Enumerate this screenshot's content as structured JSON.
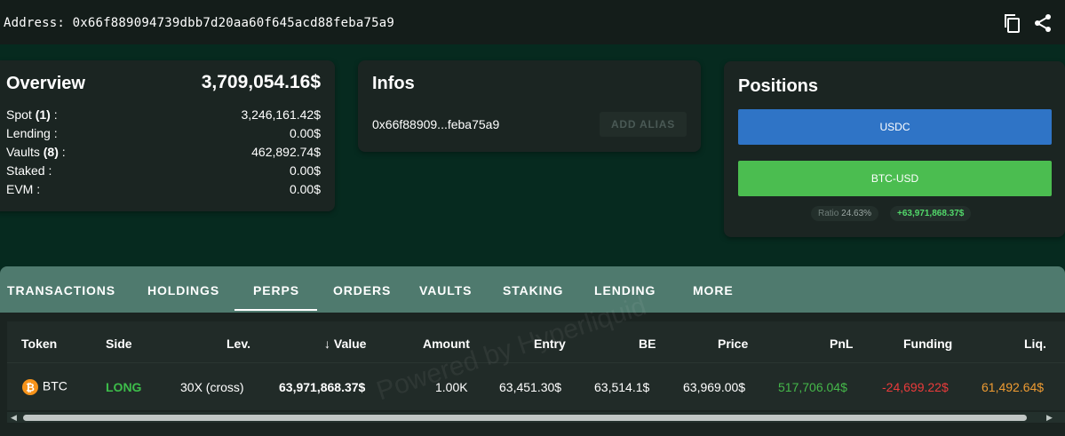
{
  "address_bar": {
    "text": "Address: 0x66f889094739dbb7d20aa60f645acd88feba75a9",
    "copy_icon": "copy-icon",
    "share_icon": "share-icon"
  },
  "overview": {
    "title": "Overview",
    "total": "3,709,054.16$",
    "rows": [
      {
        "label_pre": "Spot ",
        "label_count": "(1)",
        "label_post": " :",
        "value": "3,246,161.42$"
      },
      {
        "label_pre": "Lending :",
        "label_count": "",
        "label_post": "",
        "value": "0.00$"
      },
      {
        "label_pre": "Vaults ",
        "label_count": "(8)",
        "label_post": " :",
        "value": "462,892.74$"
      },
      {
        "label_pre": "Staked :",
        "label_count": "",
        "label_post": "",
        "value": "0.00$"
      },
      {
        "label_pre": "EVM :",
        "label_count": "",
        "label_post": "",
        "value": "0.00$"
      }
    ]
  },
  "infos": {
    "title": "Infos",
    "short_address": "0x66f88909...feba75a9",
    "alias_button": "ADD ALIAS"
  },
  "positions": {
    "title": "Positions",
    "buttons": [
      "USDC",
      "BTC-USD"
    ],
    "ratio_label": "Ratio",
    "ratio_value": "24.63%",
    "pnl": "+63,971,868.37$"
  },
  "tabs": [
    "TRANSACTIONS",
    "HOLDINGS",
    "PERPS",
    "ORDERS",
    "VAULTS",
    "STAKING",
    "LENDING",
    "MORE"
  ],
  "active_tab": "PERPS",
  "table": {
    "headers": [
      "Token",
      "Side",
      "Lev.",
      "Value",
      "Amount",
      "Entry",
      "BE",
      "Price",
      "PnL",
      "Funding",
      "Liq."
    ],
    "sort_icon": "arrow-down-icon",
    "rows": [
      {
        "token": "BTC",
        "side": "LONG",
        "lev": "30X (cross)",
        "value": "63,971,868.37$",
        "amount": "1.00K",
        "entry": "63,451.30$",
        "be": "63,514.1$",
        "price": "63,969.00$",
        "pnl": "517,706.04$",
        "funding": "-24,699.22$",
        "liq": "61,492.64$"
      }
    ],
    "watermark": "Powered by Hyperliquid"
  },
  "colors": {
    "background": "#062a1f",
    "usdc": "#2f74c6",
    "btc": "#4bbd50",
    "positive": "#45b84a",
    "negative": "#ea3b3b",
    "liq": "#ee9b32",
    "tab_bar": "#4f7a6e"
  }
}
